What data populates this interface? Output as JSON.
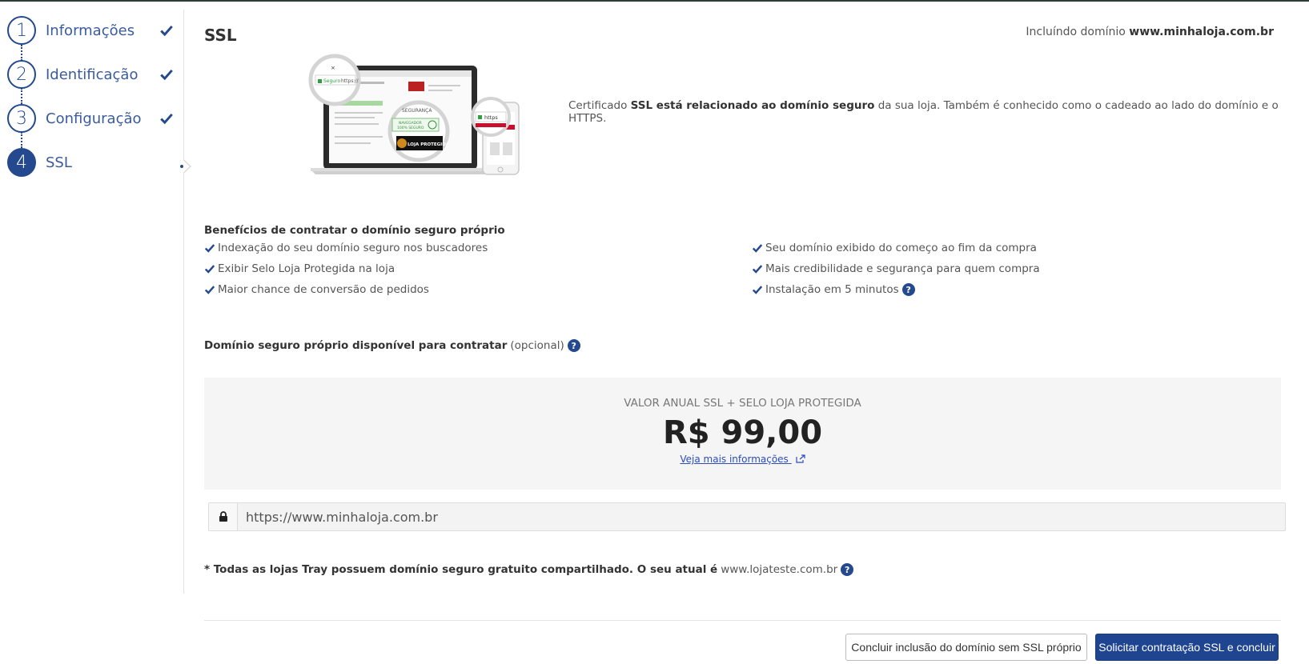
{
  "steps": [
    {
      "number": "1",
      "label": "Informações",
      "done": true
    },
    {
      "number": "2",
      "label": "Identificação",
      "done": true
    },
    {
      "number": "3",
      "label": "Configuração",
      "done": true
    },
    {
      "number": "4",
      "label": "SSL",
      "done": false
    }
  ],
  "header": {
    "title": "SSL",
    "domain_prefix": "Incluíndo domínio",
    "domain": "www.minhaloja.com.br"
  },
  "illustration": {
    "secure_label": "Seguro",
    "https_label": "https://",
    "https_badge": "https",
    "seal_line1": "NAVEGADOR",
    "seal_line2": "100% SEGURO",
    "shield_text": "LOJA PROTEGIDA",
    "security_label": "SEGURANÇA"
  },
  "description": {
    "prefix": "Certificado",
    "bold": "SSL está relacionado ao domínio seguro",
    "suffix": "da sua loja. Também é conhecido como o cadeado ao lado do domínio e o HTTPS."
  },
  "benefits": {
    "title": "Benefícios de contratar o domínio seguro próprio",
    "left": [
      "Indexação do seu domínio seguro nos buscadores",
      "Exibir Selo Loja Protegida na loja",
      "Maior chance de conversão de pedidos"
    ],
    "right": [
      "Seu domínio exibido do começo ao fim da compra",
      "Mais credibilidade e segurança para quem compra",
      "Instalação em 5 minutos"
    ]
  },
  "offer": {
    "title_bold": "Domínio seguro próprio disponível para contratar",
    "title_optional": "(opcional)",
    "caption": "VALOR ANUAL SSL + SELO LOJA PROTEGIDA",
    "price": "R$ 99,00",
    "link": "Veja mais informações"
  },
  "url_field": {
    "value": "https://www.minhaloja.com.br"
  },
  "footnote": {
    "bold": "* Todas as lojas Tray possuem domínio seguro gratuito compartilhado. O seu atual é",
    "domain": "www.lojateste.com.br"
  },
  "help_symbol": "?",
  "actions": {
    "secondary": "Concluir inclusão do domínio sem SSL próprio",
    "primary": "Solicitar contratação SSL e concluir"
  },
  "colors": {
    "accent": "#24498f",
    "primary_button": "#1f4591",
    "panel": "#f5f5f5"
  }
}
